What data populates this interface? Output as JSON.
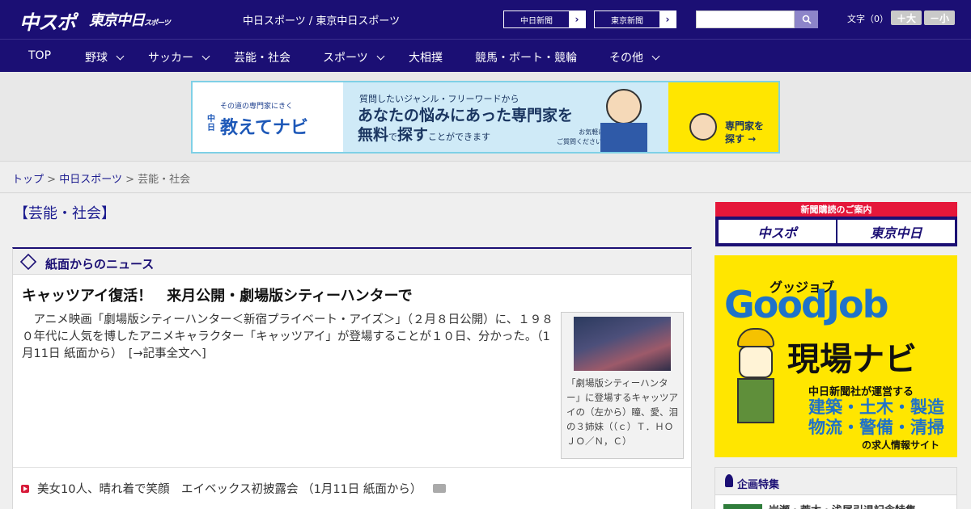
{
  "header": {
    "logo_main": "中スポ",
    "logo_tokyo": "東京中日",
    "logo_tokyo_suffix": "スポーツ",
    "tagline": "中日スポーツ / 東京中日スポーツ",
    "links": [
      {
        "label": "中日新聞",
        "arrow": "›"
      },
      {
        "label": "東京新聞",
        "arrow": "›"
      }
    ],
    "search": {
      "placeholder": ""
    },
    "font_size": {
      "label": "文字（0）",
      "larger": "＋大",
      "smaller": "－小"
    }
  },
  "nav": {
    "items": [
      {
        "label": "TOP",
        "dropdown": false
      },
      {
        "label": "野球",
        "dropdown": true
      },
      {
        "label": "サッカー",
        "dropdown": true
      },
      {
        "label": "芸能・社会",
        "dropdown": false
      },
      {
        "label": "スポーツ",
        "dropdown": true
      },
      {
        "label": "大相撲",
        "dropdown": false
      },
      {
        "label": "競馬・ボート・競輪",
        "dropdown": false
      },
      {
        "label": "その他",
        "dropdown": true
      }
    ]
  },
  "banner": {
    "small": "その道の専門家にきく",
    "chu": "中日",
    "brand": "教えてナビ",
    "line1": "質問したいジャンル・フリーワードから",
    "line2": "あなたの悩みにあった専門家を",
    "line3_strong_1": "無料",
    "line3_mid": "で",
    "line3_strong_2": "探す",
    "line3_tail": "ことができます",
    "note_1": "お気軽に",
    "note_2": "ご質問ください!",
    "cta_1": "専門家を",
    "cta_2": "探す →"
  },
  "breadcrumb": {
    "home": "トップ",
    "sep": ">",
    "section": "中日スポーツ",
    "current": "芸能・社会"
  },
  "page_title": "【芸能・社会】",
  "news": {
    "heading": "紙面からのニュース",
    "headline": "キャッツアイ復活！　来月公開・劇場版シティーハンターで",
    "body": "　アニメ映画「劇場版シティーハンター＜新宿プライベート・アイズ＞」（２月８日公開）に、１９８０年代に人気を博したアニメキャラクター「キャッツアイ」が登場することが１０日、分かった。（1月11日 紙面から）　[→記事全文へ]",
    "photo_caption": "「劇場版シティーハンター」に登場するキャッツアイの（左から）瞳、愛、泪の３姉妹（（ｃ）Ｔ．ＨＯＪＯ／Ｎ，Ｃ）",
    "list": [
      {
        "title": "美女10人、晴れ着で笑顔　エイベックス初披露会 （1月11日 紙面から）"
      }
    ]
  },
  "sidebar": {
    "subscribe_title": "新聞購読のご案内",
    "subscribe_buttons": [
      "中スポ",
      "東京中日"
    ],
    "goodjob": {
      "kana": "グッジョブ",
      "logo": "GoodJob",
      "title": "現場ナビ",
      "operator": "中日新聞社が運営する",
      "cats_1": "建築・土木・製造",
      "cats_2": "物流・警備・清掃",
      "site": "の求人情報サイト"
    },
    "kikaku": {
      "heading": "企画特集",
      "item": "岩瀬・荒木・浅尾引退記念特集"
    }
  },
  "colors": {
    "brand_navy": "#1b0f74",
    "accent_red": "#d81b3a",
    "banner_blue": "#cfeaf7",
    "goodjob_yellow": "#ffe600"
  }
}
